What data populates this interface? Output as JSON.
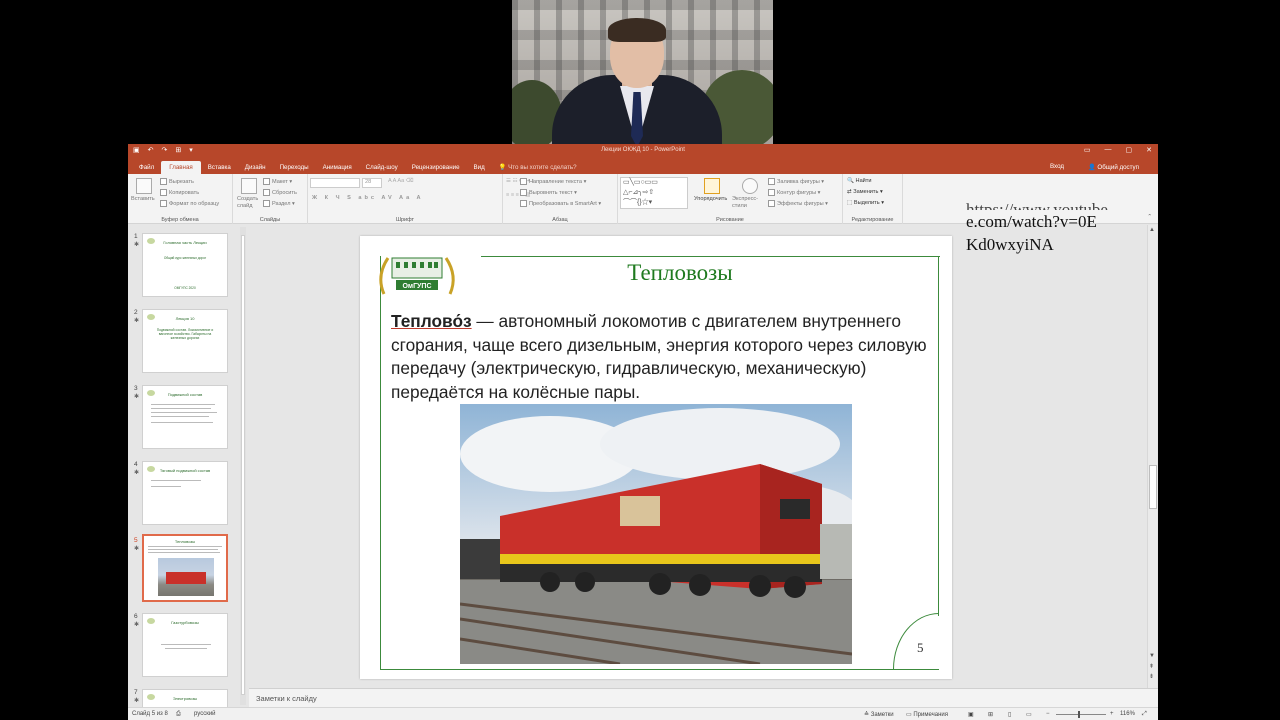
{
  "window": {
    "title": "Лекции ОКЖД 10 - PowerPoint",
    "controls": [
      "—",
      "▢",
      "✕"
    ]
  },
  "tabs": [
    {
      "label": "Файл",
      "active": false
    },
    {
      "label": "Главная",
      "active": true
    },
    {
      "label": "Вставка",
      "active": false
    },
    {
      "label": "Дизайн",
      "active": false
    },
    {
      "label": "Переходы",
      "active": false
    },
    {
      "label": "Анимация",
      "active": false
    },
    {
      "label": "Слайд-шоу",
      "active": false
    },
    {
      "label": "Рецензирование",
      "active": false
    },
    {
      "label": "Вид",
      "active": false
    }
  ],
  "tell_me": "Что вы хотите сделать?",
  "account": {
    "sign_in": "Вход",
    "share": "Общий доступ"
  },
  "ribbon": {
    "clipboard": {
      "paste": "Вставить",
      "cut": "Вырезать",
      "copy": "Копировать",
      "format_painter": "Формат по образцу",
      "label": "Буфер обмена"
    },
    "slides": {
      "new_slide": "Создать слайд",
      "layout": "Макет",
      "reset": "Сбросить",
      "section": "Раздел",
      "label": "Слайды"
    },
    "font": {
      "size": "28",
      "label": "Шрифт"
    },
    "paragraph": {
      "text_direction": "Направление текста",
      "align_text": "Выровнять текст",
      "smartart": "Преобразовать в SmartArt",
      "label": "Абзац"
    },
    "drawing": {
      "arrange": "Упорядочить",
      "quick_styles": "Экспресс-стили",
      "shape_fill": "Заливка фигуры",
      "shape_outline": "Контур фигуры",
      "shape_effects": "Эффекты фигуры",
      "label": "Рисование"
    },
    "editing": {
      "find": "Найти",
      "replace": "Заменить",
      "select": "Выделить",
      "label": "Редактирование"
    }
  },
  "thumbnails": [
    {
      "num": "1",
      "title": "Головная часть Лекции",
      "body": "Общий курс железных дорог",
      "foot": "ОМГУПС 2020"
    },
    {
      "num": "2",
      "title": "Лекция 10",
      "body": "Подвижной состав. Локомотивное и вагонное хозяйство. Габариты на железных дорогах",
      "foot": ""
    },
    {
      "num": "3",
      "title": "Подвижной состав",
      "body": "",
      "foot": ""
    },
    {
      "num": "4",
      "title": "Тяговый подвижной состав",
      "body": "",
      "foot": ""
    },
    {
      "num": "5",
      "title": "Тепловозы",
      "body": "",
      "foot": ""
    },
    {
      "num": "6",
      "title": "Газотурбовозы",
      "body": "",
      "foot": ""
    },
    {
      "num": "7",
      "title": "Электровозы",
      "body": "",
      "foot": ""
    }
  ],
  "slide": {
    "logo_text": "ОмГУПС",
    "title": "Тепловозы",
    "term": "Теплово́з",
    "body": " — автономный локомотив с двигателем внутреннего сгорания, чаще всего дизельным, энергия которого через силовую передачу (электрическую, гидравлическую, механическую) передаётся на колёсные пары.",
    "number": "5"
  },
  "overlay_url": {
    "line1": "https://www.youtube",
    "line2": "e.com/watch?v=0E",
    "line3": "Kd0wxyiNA"
  },
  "notes_placeholder": "Заметки к слайду",
  "status": {
    "slide_of": "Слайд 5 из 8",
    "language": "русский",
    "notes": "Заметки",
    "comments": "Примечания",
    "zoom": "116%"
  },
  "colors": {
    "accent": "#b7472a",
    "slide_green": "#1f7a1f"
  }
}
